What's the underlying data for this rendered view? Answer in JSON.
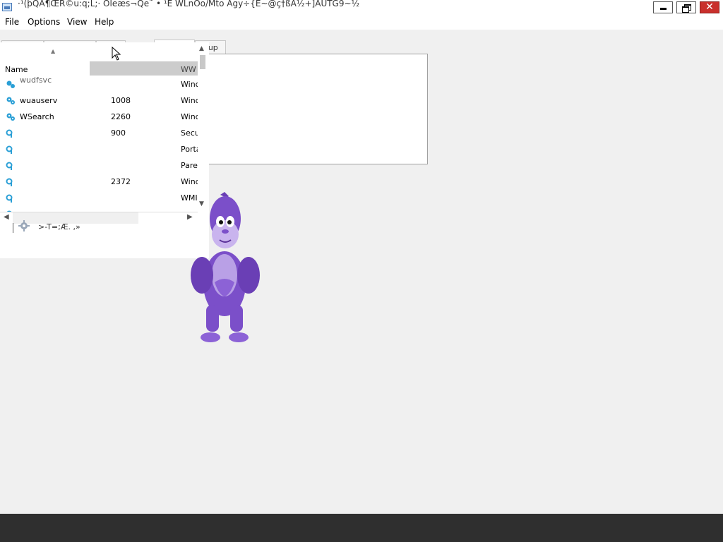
{
  "window": {
    "title": "·¹(þQA¶ŒR©u:q;L;· Oleæs¬Qe˜ • ¹E WLnOo/Mto    Agy÷{E~@ç†ßA½+]AUTG9~½",
    "minimize_label": "",
    "maximize_label": "",
    "close_label": "✕"
  },
  "menu": {
    "items": [
      {
        "label": "File"
      },
      {
        "label": "Options"
      },
      {
        "label": "View"
      },
      {
        "label": "Help"
      }
    ]
  },
  "tabs": {
    "partial_label": "rtup"
  },
  "list": {
    "columns": {
      "name": "Name"
    },
    "rows": [
      {
        "name": "wuauserv",
        "pid": "1008",
        "desc": "Winc"
      },
      {
        "name": "WSearch",
        "pid": "2260",
        "desc": "Winc"
      },
      {
        "name": "",
        "pid": "900",
        "desc": "Secu"
      },
      {
        "name": "",
        "pid": "",
        "desc": "Porta"
      },
      {
        "name": "",
        "pid": "",
        "desc": "Pare"
      },
      {
        "name": "",
        "pid": "2372",
        "desc": "Winc"
      },
      {
        "name": "",
        "pid": "",
        "desc": "WMI"
      }
    ],
    "partial_row": {
      "name": "wudfsvc",
      "desc": "Winc"
    },
    "selected_row_desc": "WW"
  },
  "status": {
    "text": ">-T=;Æ. ,»"
  },
  "colors": {
    "accent": "#2a9fd6",
    "gorilla_purple": "#7b4fc9",
    "taskbar": "#2f2f2f"
  }
}
